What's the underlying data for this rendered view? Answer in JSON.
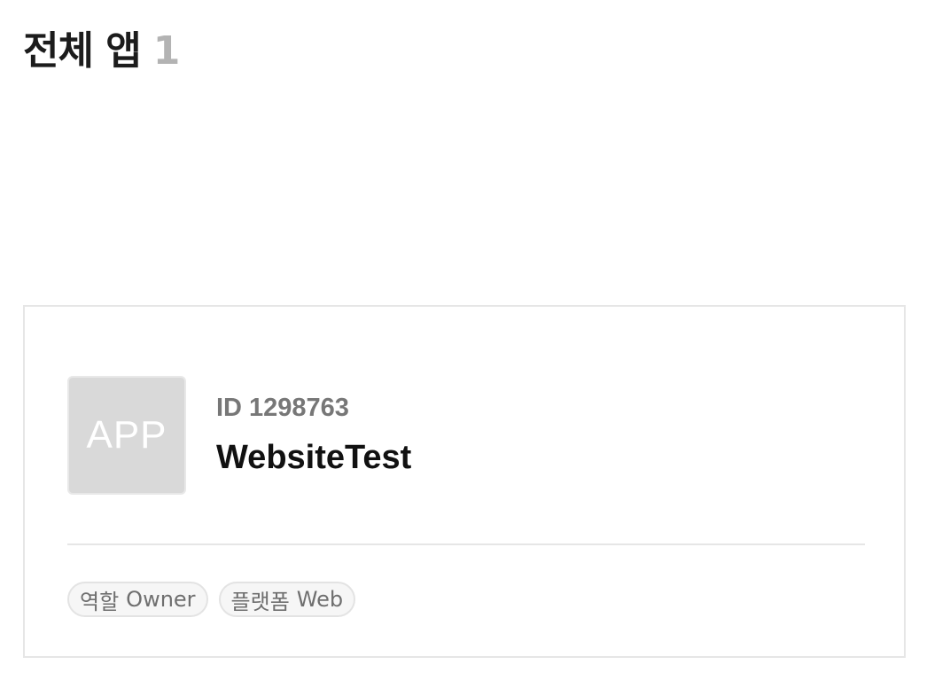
{
  "header": {
    "title": "전체 앱",
    "count": "1"
  },
  "app_card": {
    "thumbnail_label": "APP",
    "id_label": "ID",
    "id_value": "1298763",
    "name": "WebsiteTest",
    "tags": [
      {
        "label": "역할",
        "value": "Owner"
      },
      {
        "label": "플랫폼",
        "value": "Web"
      }
    ]
  },
  "colors": {
    "title": "#1c1c1c",
    "count": "#b3b3b3",
    "thumbnail_bg": "#d9d9d9",
    "muted_text": "#777777",
    "border": "#e6e6e6",
    "tag_bg": "#f6f6f6"
  }
}
